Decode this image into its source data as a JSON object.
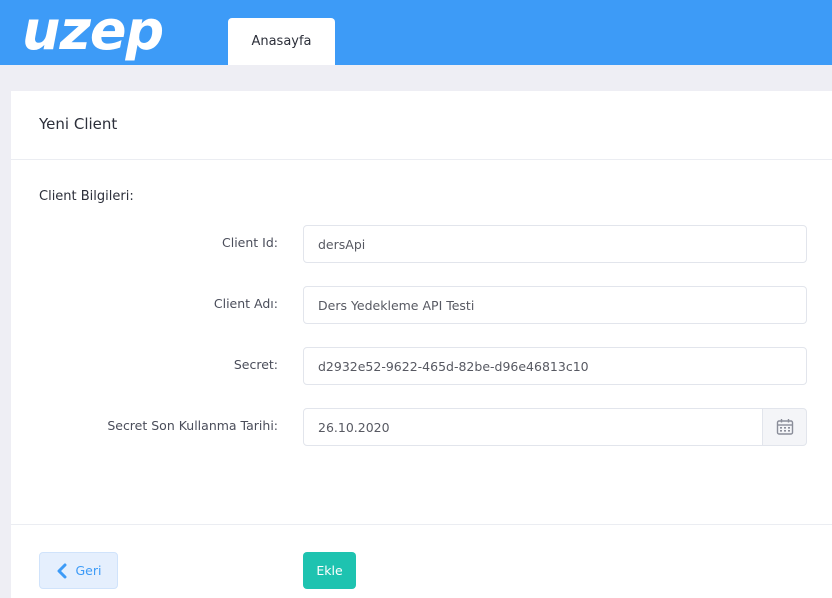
{
  "header": {
    "logo_text": "UZEP",
    "tab_label": "Anasayfa",
    "brand_color": "#3d9bf7"
  },
  "card": {
    "title": "Yeni Client",
    "section_title": "Client Bilgileri:"
  },
  "form": {
    "client_id_label": "Client Id:",
    "client_id_value": "dersApi",
    "client_name_label": "Client Adı:",
    "client_name_value": "Ders Yedekleme API Testi",
    "secret_label": "Secret:",
    "secret_value": "d2932e52-9622-465d-82be-d96e46813c10",
    "secret_expiry_label": "Secret Son Kullanma Tarihi:",
    "secret_expiry_value": "26.10.2020",
    "calendar_icon": "calendar-icon"
  },
  "footer": {
    "back_label": "Geri",
    "add_label": "Ekle",
    "add_color": "#1ec3b0"
  }
}
